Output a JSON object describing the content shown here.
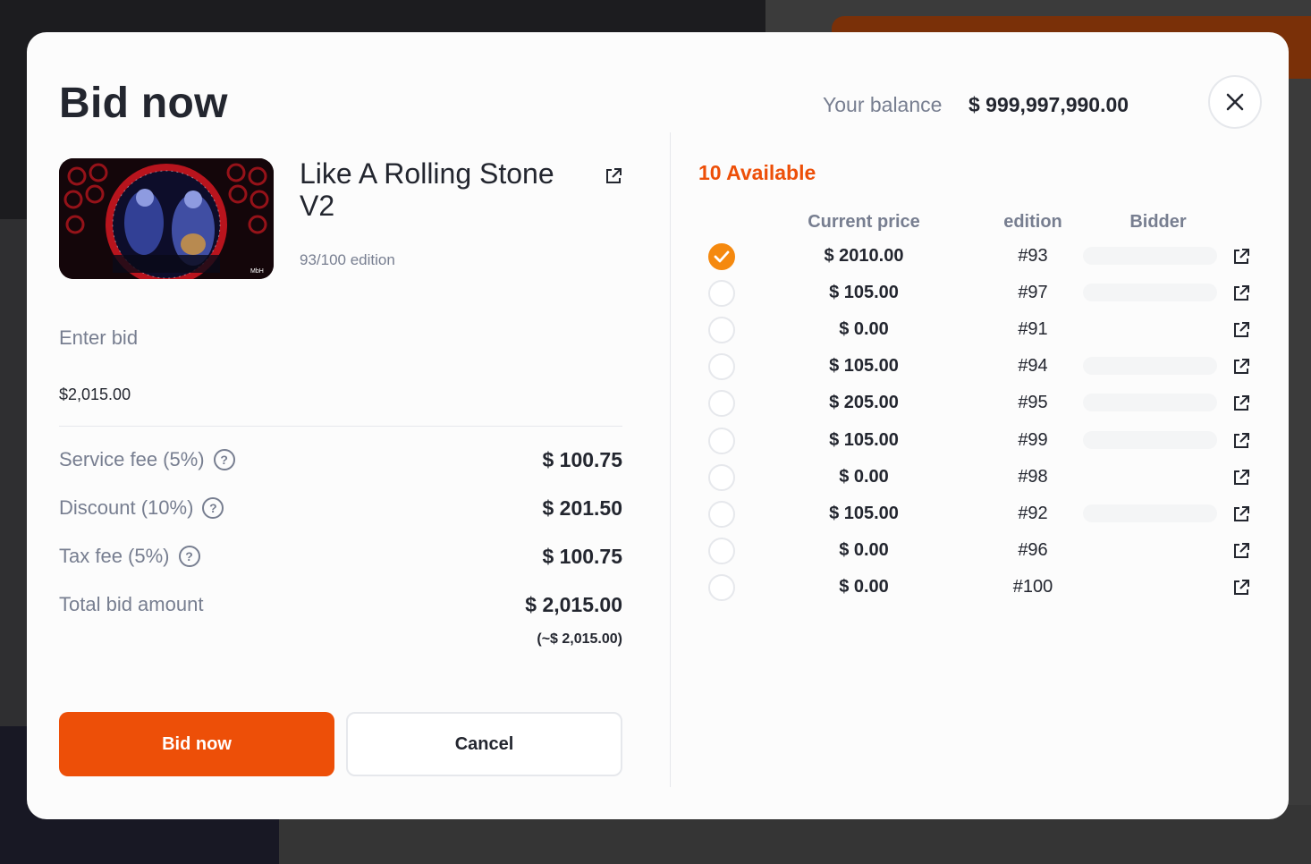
{
  "modal": {
    "title": "Bid now",
    "balance_label": "Your balance",
    "balance_value": "$ 999,997,990.00"
  },
  "item": {
    "name": "Like A Rolling Stone V2",
    "edition": "93/100 edition"
  },
  "bid": {
    "label": "Enter bid",
    "value": "$2,015.00"
  },
  "fees": [
    {
      "label": "Service fee (5%)",
      "value": "$ 100.75",
      "help": true
    },
    {
      "label": "Discount (10%)",
      "value": "$ 201.50",
      "help": true
    },
    {
      "label": "Tax fee (5%)",
      "value": "$ 100.75",
      "help": true
    },
    {
      "label": "Total bid amount",
      "value": "$ 2,015.00",
      "help": false
    }
  ],
  "total_approx": "(~$ 2,015.00)",
  "buttons": {
    "bid_now": "Bid now",
    "cancel": "Cancel"
  },
  "editions_panel": {
    "available": "10 Available",
    "headers": {
      "price": "Current price",
      "edition": "edition",
      "bidder": "Bidder"
    },
    "rows": [
      {
        "price": "$ 2010.00",
        "edition": "#93",
        "selected": true,
        "has_bidder": true
      },
      {
        "price": "$ 105.00",
        "edition": "#97",
        "selected": false,
        "has_bidder": true
      },
      {
        "price": "$ 0.00",
        "edition": "#91",
        "selected": false,
        "has_bidder": false
      },
      {
        "price": "$ 105.00",
        "edition": "#94",
        "selected": false,
        "has_bidder": true
      },
      {
        "price": "$ 205.00",
        "edition": "#95",
        "selected": false,
        "has_bidder": true
      },
      {
        "price": "$ 105.00",
        "edition": "#99",
        "selected": false,
        "has_bidder": true
      },
      {
        "price": "$ 0.00",
        "edition": "#98",
        "selected": false,
        "has_bidder": false
      },
      {
        "price": "$ 105.00",
        "edition": "#92",
        "selected": false,
        "has_bidder": true
      },
      {
        "price": "$ 0.00",
        "edition": "#96",
        "selected": false,
        "has_bidder": false
      },
      {
        "price": "$ 0.00",
        "edition": "#100",
        "selected": false,
        "has_bidder": false
      }
    ]
  },
  "icons": {
    "close": "close-icon",
    "external_link": "external-link-icon",
    "help": "help-icon",
    "check": "check-icon"
  },
  "colors": {
    "accent": "#ed4f08",
    "selected_radio": "#f5890f",
    "muted_text": "#777e90",
    "primary_text": "#23262f"
  }
}
